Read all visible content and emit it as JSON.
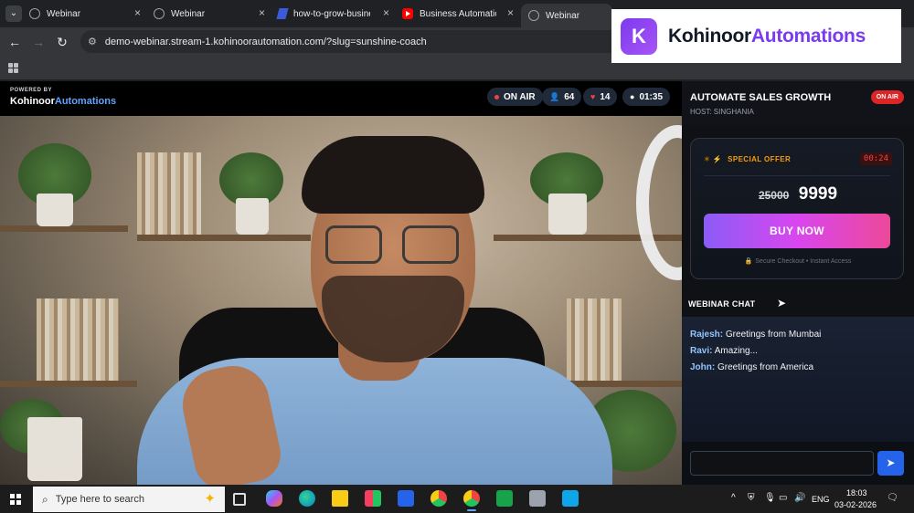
{
  "browser": {
    "tabs": [
      {
        "title": "Webinar",
        "icon": "globe-icon",
        "active": false
      },
      {
        "title": "Webinar",
        "icon": "globe-icon",
        "active": false
      },
      {
        "title": "how-to-grow-busine",
        "icon": "document-icon",
        "active": false
      },
      {
        "title": "Business Automation",
        "icon": "youtube-icon",
        "active": false
      },
      {
        "title": "Webinar",
        "icon": "globe-icon",
        "active": true
      }
    ],
    "url": "demo-webinar.stream-1.kohinoorautomation.com/?slug=sunshine-coach"
  },
  "overlay_brand": {
    "badge": "K",
    "name_part1": "Kohinoor",
    "name_part2": "Automations"
  },
  "stage": {
    "powered_by": "POWERED BY",
    "brand_part1": "Kohinoor",
    "brand_part2": "Automations",
    "status_label": "ON AIR",
    "viewers": "64",
    "likes": "14",
    "elapsed": "01:35"
  },
  "sidebar": {
    "title": "AUTOMATE SALES GROWTH",
    "host": "HOST: SINGHANIA",
    "badge": "ON AIR",
    "offer": {
      "label": "SPECIAL OFFER",
      "timer": "00:24",
      "old_price": "25000",
      "new_price": "9999",
      "button": "BUY NOW",
      "secure_text": "Secure Checkout • Instant Access"
    },
    "chat_label": "WEBINAR CHAT",
    "messages": [
      {
        "user": "Rajesh:",
        "text": "Greetings from Mumbai"
      },
      {
        "user": "Ravi:",
        "text": "Amazing..."
      },
      {
        "user": "John:",
        "text": "Greetings from America"
      }
    ],
    "input_value": ""
  },
  "taskbar": {
    "search_placeholder": "Type here to search",
    "language": "ENG",
    "time": "18:03",
    "date": "03-02-2026"
  },
  "colors": {
    "accent": "#7c3aed",
    "onair": "#dc2626",
    "offer_gold": "#f59e0b",
    "send": "#2563eb"
  }
}
